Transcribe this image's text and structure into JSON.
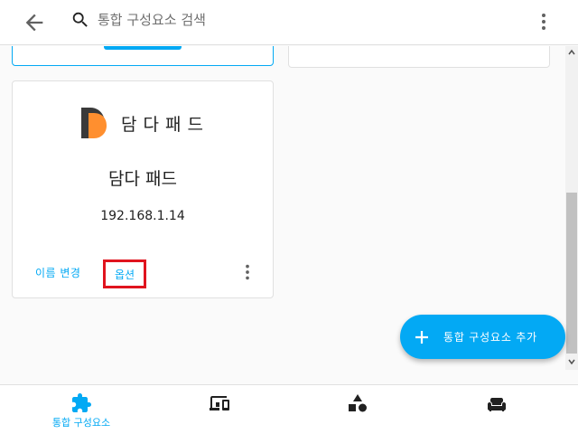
{
  "header": {
    "search_placeholder": "통합 구성요소 검색",
    "back_icon": "arrow-left-icon",
    "search_icon": "magnify-icon",
    "menu_icon": "dots-vertical-icon"
  },
  "card": {
    "logo_text": "담다패드",
    "title": "담다 패드",
    "ip": "192.168.1.14",
    "rename_label": "이름 변경",
    "options_label": "옵션",
    "menu_icon": "dots-vertical-icon"
  },
  "fab": {
    "label": "통합 구성요소 추가",
    "icon": "plus-icon"
  },
  "bottom_nav": {
    "items": [
      {
        "label": "통합 구성요소",
        "icon": "puzzle-icon",
        "active": true
      },
      {
        "label": "",
        "icon": "devices-icon",
        "active": false
      },
      {
        "label": "",
        "icon": "shapes-icon",
        "active": false
      },
      {
        "label": "",
        "icon": "sofa-icon",
        "active": false
      }
    ]
  },
  "colors": {
    "accent": "#03a9f4",
    "highlight_box": "#e0141e",
    "logo_dark": "#3a3a3a",
    "logo_orange": "#ff8f2f",
    "icon_gray": "#616161"
  }
}
